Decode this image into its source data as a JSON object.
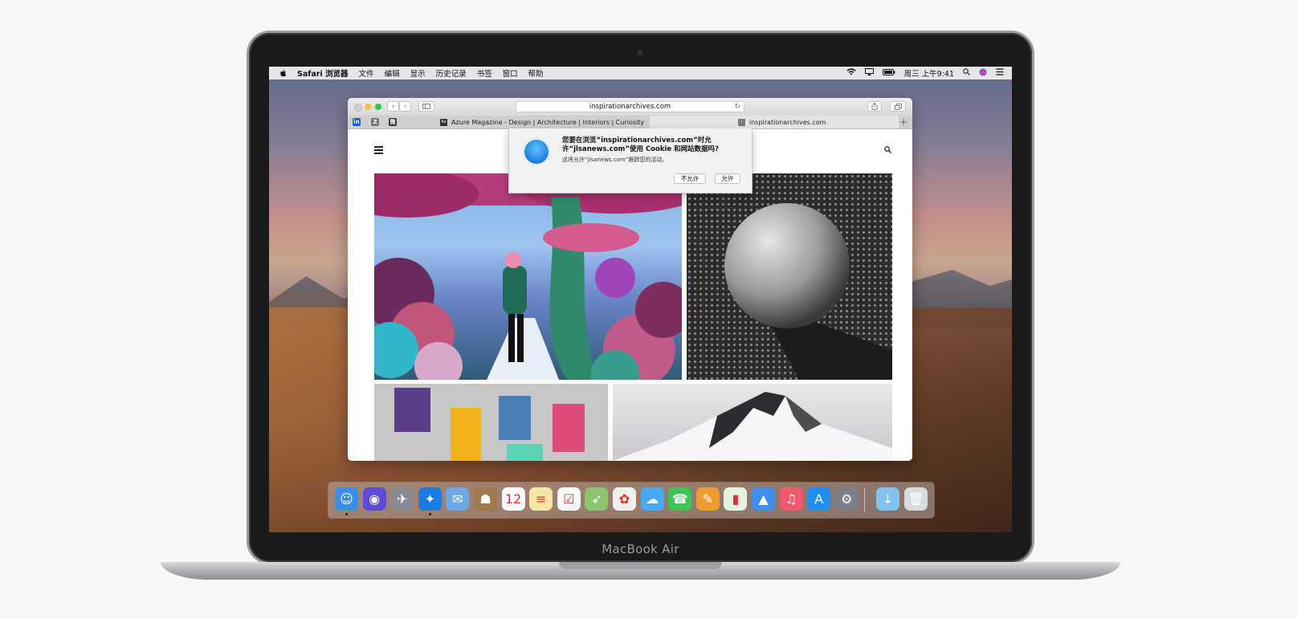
{
  "device": {
    "chin_label": "MacBook Air"
  },
  "menubar": {
    "apple": "",
    "app_name": "Safari 浏览器",
    "items": [
      "文件",
      "编辑",
      "显示",
      "历史记录",
      "书签",
      "窗口",
      "帮助"
    ],
    "clock": "周三 上午9:41",
    "status_icons": [
      "wifi-icon",
      "airplay-icon",
      "battery-icon",
      "spotlight-icon",
      "siri-icon",
      "control-center-icon"
    ]
  },
  "browser": {
    "url": "inspirationarchives.com",
    "pinned_tabs": [
      {
        "icon": "linkedin-icon",
        "glyph": "in",
        "color": "#0a66c2"
      },
      {
        "icon": "z-icon",
        "glyph": "Z",
        "color": "#777777"
      },
      {
        "icon": "weibo-icon",
        "glyph": "微",
        "color": "#333333"
      }
    ],
    "tabs": [
      {
        "favicon": "Az",
        "title": "Azure Magazine - Design | Architecture | Interiors | Curiosity"
      },
      {
        "favicon": "i",
        "title": "inspirationarchives.com"
      }
    ],
    "new_tab_glyph": "+"
  },
  "dialog": {
    "title": "您要在浏览“inspirationarchives.com”时允许“jlsanews.com”使用 Cookie 和网站数据吗?",
    "subtitle": "这将允许“jlsanews.com”跟踪您的活动。",
    "deny_label": "不允许",
    "allow_label": "允许"
  },
  "dock": {
    "apps": [
      {
        "name": "finder-icon",
        "glyph": "☺",
        "color": "#3b8ee8",
        "running": true
      },
      {
        "name": "siri-icon",
        "glyph": "◉",
        "color": "#5b4bd6",
        "running": false
      },
      {
        "name": "launchpad-icon",
        "glyph": "✈",
        "color": "#8a8a92",
        "running": false
      },
      {
        "name": "safari-icon",
        "glyph": "✦",
        "color": "#1a7be0",
        "running": true
      },
      {
        "name": "mail-icon",
        "glyph": "✉",
        "color": "#6aa8e8",
        "running": false
      },
      {
        "name": "contacts-icon",
        "glyph": "☗",
        "color": "#a07a4a",
        "running": false
      },
      {
        "name": "calendar-icon",
        "glyph": "12",
        "color": "#ffffff",
        "running": false
      },
      {
        "name": "notes-icon",
        "glyph": "≡",
        "color": "#f4e7a3",
        "running": false
      },
      {
        "name": "reminders-icon",
        "glyph": "☑",
        "color": "#fafafa",
        "running": false
      },
      {
        "name": "maps-icon",
        "glyph": "➶",
        "color": "#8cc46f",
        "running": false
      },
      {
        "name": "photos-icon",
        "glyph": "✿",
        "color": "#f0f0f0",
        "running": false
      },
      {
        "name": "messages-icon",
        "glyph": "☁",
        "color": "#4aa7f4",
        "running": false
      },
      {
        "name": "facetime-icon",
        "glyph": "☎",
        "color": "#3ec551",
        "running": false
      },
      {
        "name": "pages-icon",
        "glyph": "✎",
        "color": "#f19a2d",
        "running": false
      },
      {
        "name": "numbers-icon",
        "glyph": "▮",
        "color": "#e6f1e0",
        "running": false
      },
      {
        "name": "keynote-icon",
        "glyph": "▲",
        "color": "#3f8ef0",
        "running": false
      },
      {
        "name": "music-icon",
        "glyph": "♫",
        "color": "#f5576c",
        "running": false
      },
      {
        "name": "app-store-icon",
        "glyph": "A",
        "color": "#1c8ef4",
        "running": false
      },
      {
        "name": "system-preferences-icon",
        "glyph": "⚙",
        "color": "#7d7f86",
        "running": false
      }
    ],
    "trailing": [
      {
        "name": "downloads-folder-icon",
        "glyph": "↓",
        "color": "#7fc3ee"
      },
      {
        "name": "trash-icon",
        "glyph": "🗑",
        "color": "#d8dce0"
      }
    ]
  }
}
